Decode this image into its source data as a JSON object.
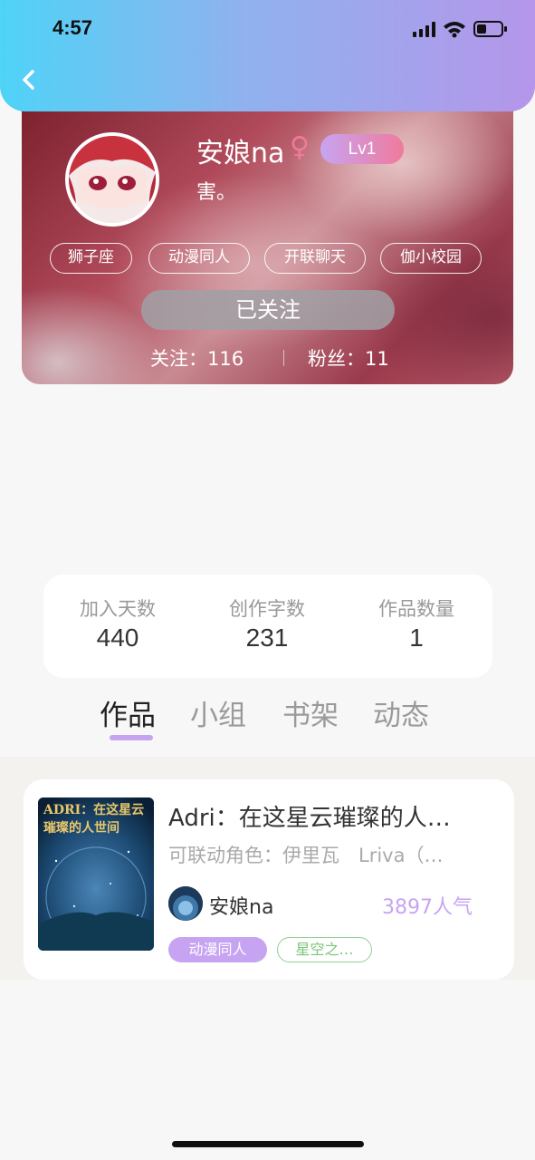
{
  "status_bar": {
    "time": "4:57"
  },
  "profile": {
    "username": "安娘na",
    "gender_symbol": "♀",
    "level": "Lv1",
    "bio": "害。",
    "tags": [
      "狮子座",
      "动漫同人",
      "开联聊天",
      "伽小校园"
    ],
    "follow_button": "已关注",
    "following": "关注：116",
    "followers": "粉丝：11"
  },
  "counts": [
    {
      "label": "加入天数",
      "value": "440"
    },
    {
      "label": "创作字数",
      "value": "231"
    },
    {
      "label": "作品数量",
      "value": "1"
    }
  ],
  "tabs": [
    "作品",
    "小组",
    "书架",
    "动态"
  ],
  "work": {
    "cover_text": "ADRI：在这星云璀璨的人世间",
    "title": "Adri：在这星云璀璨的人…",
    "subtitle": "可联动角色：伊里瓦　Lriva（…",
    "author": "安娘na",
    "popularity": "3897人气",
    "chips": [
      "动漫同人",
      "星空之…"
    ]
  },
  "colors": {
    "accent": "#c7a4f2",
    "header_start": "#4fd3f7",
    "header_end": "#b596ea"
  }
}
